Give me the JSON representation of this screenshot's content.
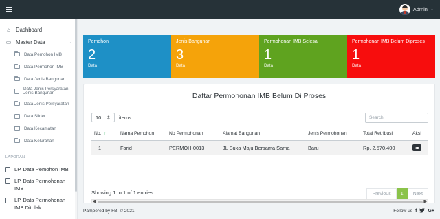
{
  "topbar": {
    "user_name": "Admin",
    "caret": "⌄"
  },
  "sidebar": {
    "dashboard_label": "Dashboard",
    "master_label": "Master Data",
    "master_caret": "⌄",
    "sub_items": [
      "Data Pemohon IMB",
      "Data Permohon IMB",
      "Data Jenis Bangunan",
      "Data Jenis Persyaratan",
      "Data Jenis Persyaratan",
      "Data Slider",
      "Data Kecamatan",
      "Data Kelurahan"
    ],
    "sub_item_4_line2": "Jenis Bangunan",
    "section_title": "LAPORAN",
    "report_items": [
      "LP. Data Pemohon IMB",
      "LP. Data Permohonan IMB",
      "LP. Data Permohonan IMB Ditolak"
    ]
  },
  "cards": [
    {
      "label": "Pemohon",
      "value": "2",
      "sub": "Data",
      "color": "#1e90c6"
    },
    {
      "label": "Jenis Bangunan",
      "value": "3",
      "sub": "Data",
      "color": "#f5a30a"
    },
    {
      "label": "Permohonan IMB Selesai",
      "value": "1",
      "sub": "Data",
      "color": "#5fa31f"
    },
    {
      "label": "Permohonan IMB Belum Diproses",
      "value": "1",
      "sub": "Data",
      "color": "#f70d0d"
    }
  ],
  "table_panel": {
    "title": "Daftar Permohonan IMB Belum Di Proses",
    "length_value": "10",
    "length_caret": "⇕",
    "length_suffix": "items",
    "search_placeholder": "Search",
    "headers": [
      "No.",
      "Nama Pemohon",
      "No Permohonan",
      "Alamat Bangunan",
      "Jenis Permohonan",
      "Total Retribusi",
      "Aksi"
    ],
    "sort_arrow": "↑",
    "rows": [
      {
        "no": "1",
        "nama": "Farid",
        "nomor": "PERMOH-0013",
        "alamat": "JL Suka Maju Bersama Sama",
        "jenis": "Baru",
        "total": "Rp. 2.570.400"
      }
    ],
    "info": "Showing 1 to 1 of 1 entries",
    "pager": {
      "prev": "Previous",
      "current": "1",
      "next": "Next"
    },
    "scroll_left": "◀",
    "scroll_right": "▶"
  },
  "footer": {
    "left_prefix": "Pampered by",
    "left_link": "FBI",
    "left_suffix": "© 2021",
    "right_text": "Follow us",
    "social": [
      "f",
      "🐦",
      "G+"
    ]
  },
  "icons": {
    "menu": "hamburger-icon",
    "dashboard": "home-icon",
    "master": "folder-icon",
    "report": "document-icon",
    "action": "eye-icon"
  }
}
